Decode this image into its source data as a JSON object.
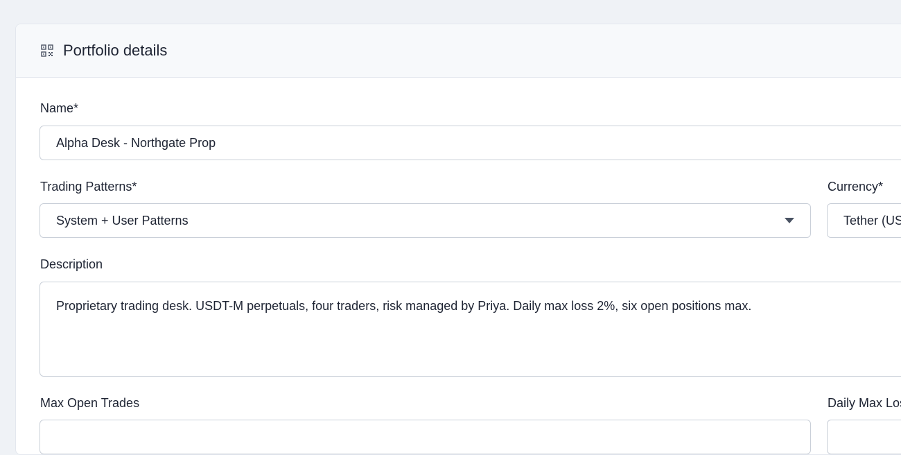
{
  "header": {
    "title": "Portfolio details",
    "icon": "qr-code-icon"
  },
  "form": {
    "name": {
      "label": "Name*",
      "value": "Alpha Desk - Northgate Prop"
    },
    "trading_patterns": {
      "label": "Trading Patterns*",
      "value": "System + User Patterns"
    },
    "currency": {
      "label": "Currency*",
      "value": "Tether (USDT)"
    },
    "description": {
      "label": "Description",
      "value": "Proprietary trading desk. USDT-M perpetuals, four traders, risk managed by Priya. Daily max loss 2%, six open positions max."
    },
    "max_open_trades": {
      "label": "Max Open Trades"
    },
    "daily_max_loss": {
      "label": "Daily Max Loss"
    }
  },
  "colors": {
    "page_background": "#eff2f6",
    "header_background": "#f7f9fb",
    "border": "#c9cfd8",
    "text": "#1e2433"
  }
}
